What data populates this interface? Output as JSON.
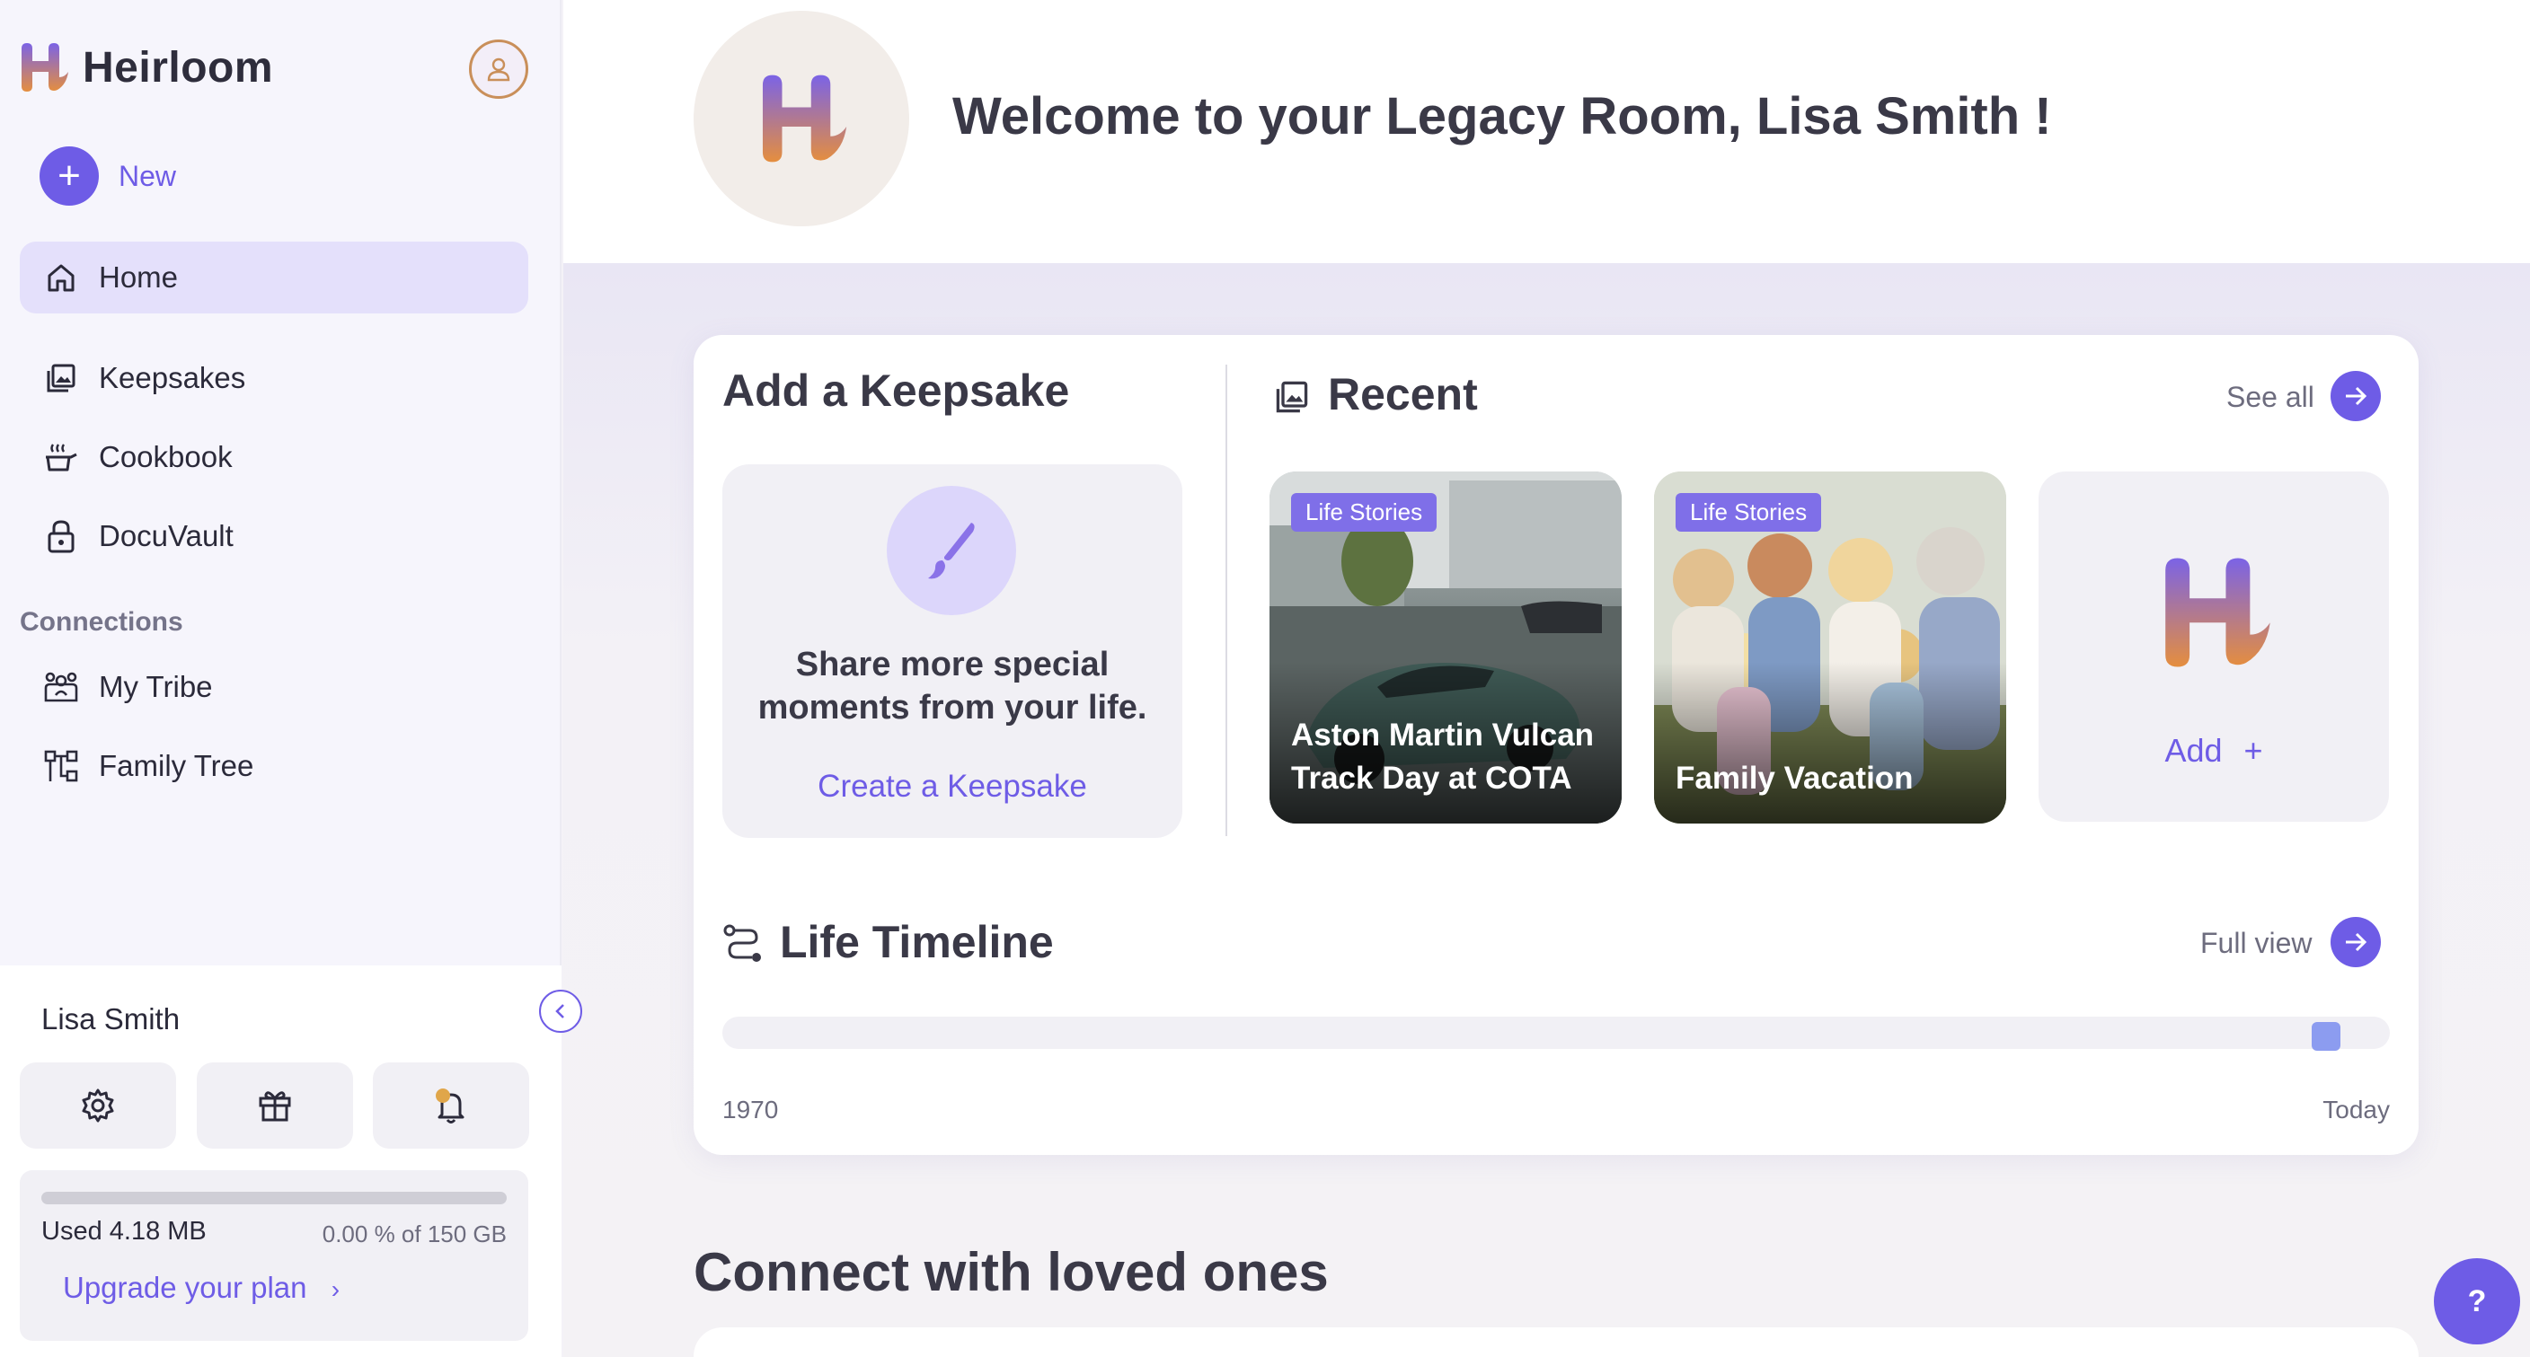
{
  "app": {
    "name": "Heirloom",
    "brand_gradient": [
      "#7b63e6",
      "#e58e3e"
    ]
  },
  "sidebar": {
    "new_label": "New",
    "nav": [
      {
        "label": "Home",
        "icon": "home-icon",
        "active": true
      },
      {
        "label": "Keepsakes",
        "icon": "image-stack-icon",
        "active": false
      },
      {
        "label": "Cookbook",
        "icon": "cooking-pot-icon",
        "active": false
      },
      {
        "label": "DocuVault",
        "icon": "lock-icon",
        "active": false
      }
    ],
    "connections_label": "Connections",
    "connections": [
      {
        "label": "My Tribe",
        "icon": "group-icon"
      },
      {
        "label": "Family Tree",
        "icon": "family-tree-icon"
      }
    ],
    "user_name": "Lisa Smith",
    "utility_buttons": [
      "settings-icon",
      "gift-icon",
      "notification-bell-icon"
    ],
    "storage": {
      "used_label": "Used 4.18 MB",
      "percent_label": "0.00 % of 150 GB",
      "percent_used": 0.0
    },
    "upgrade_label": "Upgrade your plan"
  },
  "header": {
    "welcome": "Welcome to your Legacy Room, Lisa Smith !"
  },
  "keepsake": {
    "title": "Add a Keepsake",
    "prompt": "Share more special moments from your life.",
    "create_label": "Create a Keepsake"
  },
  "recent": {
    "title": "Recent",
    "see_all_label": "See all",
    "items": [
      {
        "tag": "Life Stories",
        "title": "Aston Martin Vulcan Track Day at COTA"
      },
      {
        "tag": "Life Stories",
        "title": "Family Vacation"
      }
    ],
    "add_label": "Add"
  },
  "timeline": {
    "title": "Life Timeline",
    "full_view_label": "Full view",
    "start_label": "1970",
    "end_label": "Today",
    "marker_position_fraction": 0.97
  },
  "connect": {
    "title": "Connect with loved ones"
  },
  "colors": {
    "accent": "#6e5ce6",
    "active_nav_bg": "#e4e0fb",
    "tag_bg": "#7f6fe8"
  },
  "help": {
    "label": "?"
  }
}
